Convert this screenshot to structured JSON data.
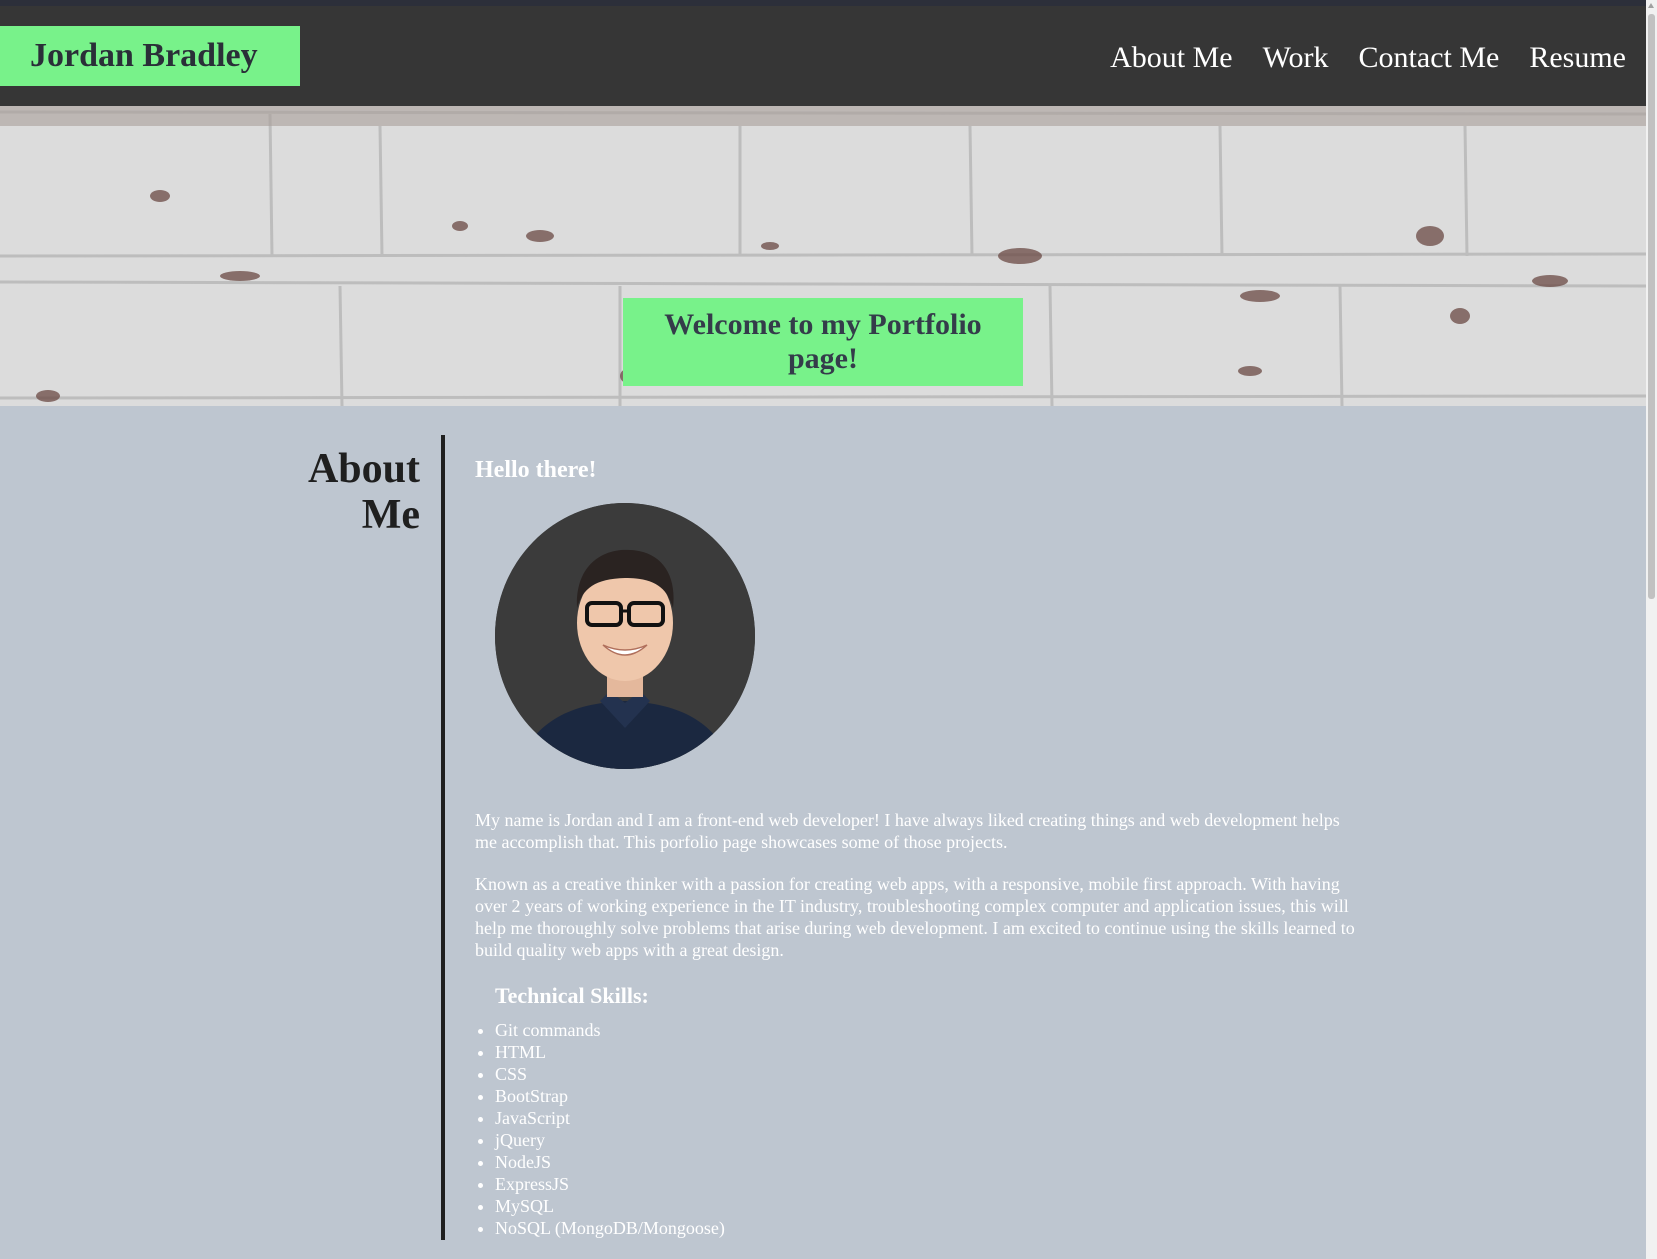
{
  "header": {
    "brand": "Jordan Bradley",
    "nav": [
      "About Me",
      "Work",
      "Contact Me",
      "Resume"
    ]
  },
  "hero": {
    "welcome": "Welcome to my Portfolio page!"
  },
  "about": {
    "heading": "About Me",
    "greeting": "Hello there!",
    "paragraph1": "My name is Jordan and I am a front-end web developer! I have always liked creating things and web development helps me accomplish that. This porfolio page showcases some of those projects.",
    "paragraph2": "Known as a creative thinker with a passion for creating web apps, with a responsive, mobile first approach. With having over 2 years of working experience in the IT industry, troubleshooting complex computer and application issues, this will help me thoroughly solve problems that arise during web development. I am excited to continue using the skills learned to build quality web apps with a great design.",
    "skills_title": "Technical Skills:",
    "skills": [
      "Git commands",
      "HTML",
      "CSS",
      "BootStrap",
      "JavaScript",
      "jQuery",
      "NodeJS",
      "ExpressJS",
      "MySQL",
      "NoSQL (MongoDB/Mongoose)"
    ]
  },
  "colors": {
    "header_bg": "#363636",
    "accent": "#78f28a",
    "page_bg": "#bec6d0"
  }
}
